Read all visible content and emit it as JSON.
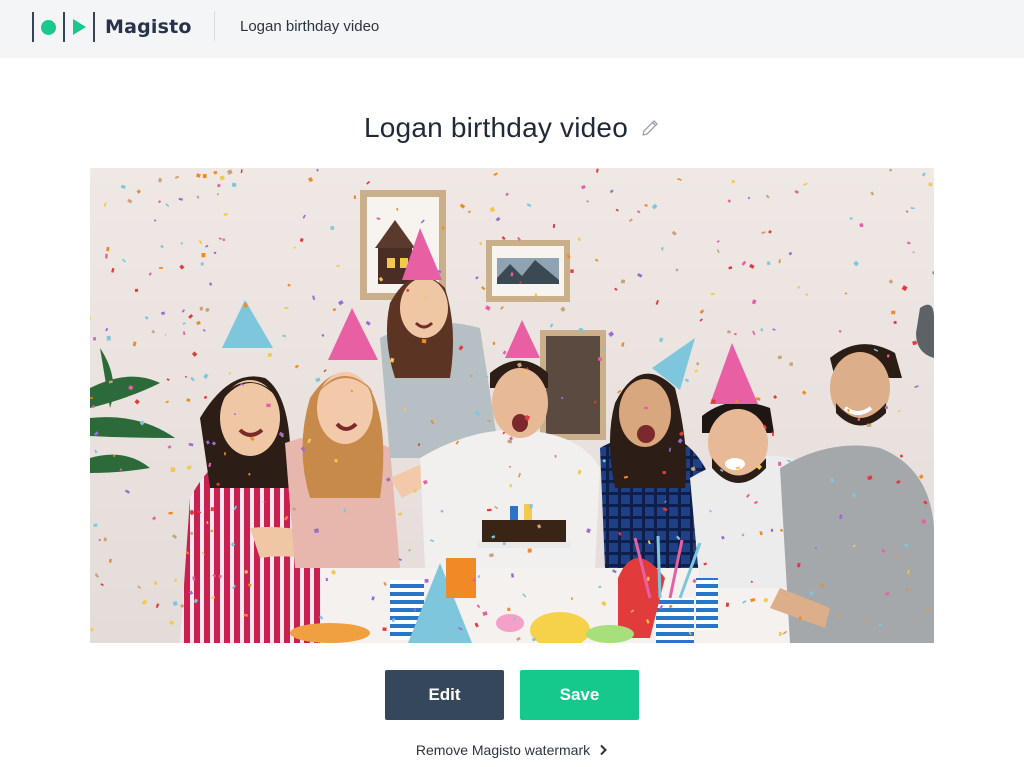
{
  "header": {
    "brand": "Magisto",
    "breadcrumb": "Logan birthday video"
  },
  "main": {
    "title": "Logan birthday video",
    "edit_label": "Edit",
    "save_label": "Save",
    "watermark_link": "Remove Magisto watermark"
  },
  "colors": {
    "accent_green": "#14c98b",
    "edit_button": "#35475a",
    "header_bg": "#f4f5f7"
  },
  "icons": {
    "logo": "magisto-logo-icon",
    "rename": "pencil-icon",
    "link_arrow": "chevron-right-icon"
  }
}
